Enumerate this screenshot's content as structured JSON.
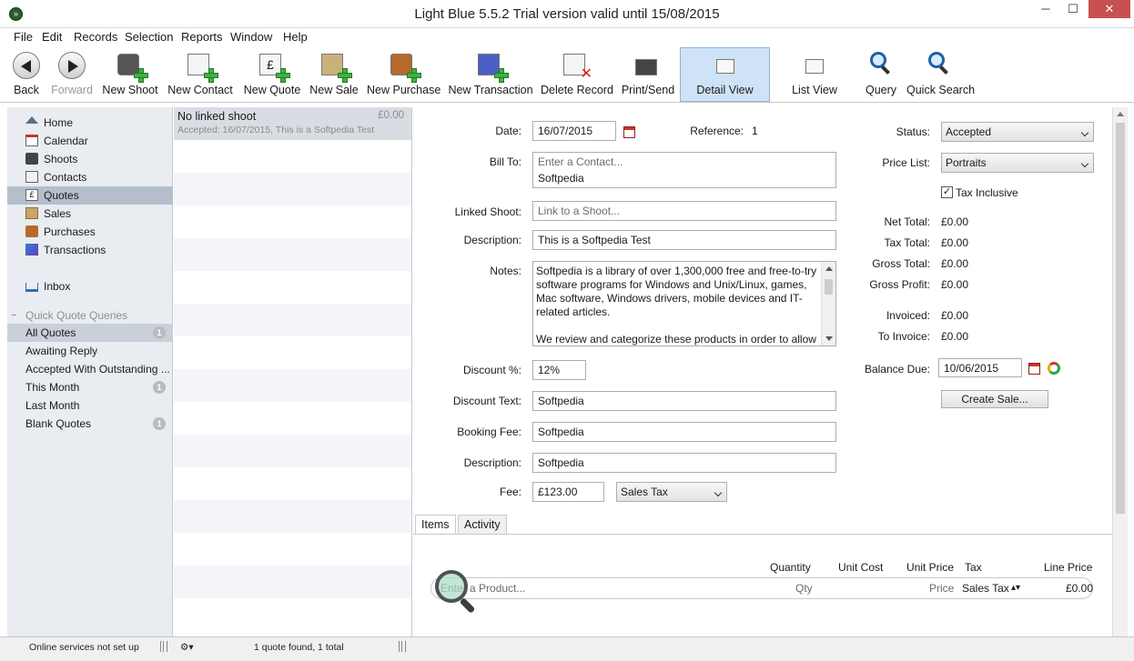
{
  "window": {
    "title": "Light Blue 5.5.2    Trial version valid until 15/08/2015",
    "minimize": "─",
    "maximize": "☐",
    "close": "✕"
  },
  "menu": [
    "File",
    "Edit",
    "Records",
    "Selection",
    "Reports",
    "Window",
    "Help"
  ],
  "toolbar": {
    "back": "Back",
    "forward": "Forward",
    "new_shoot": "New Shoot",
    "new_contact": "New Contact",
    "new_quote": "New Quote",
    "new_sale": "New Sale",
    "new_purchase": "New Purchase",
    "new_transaction": "New Transaction",
    "delete_record": "Delete Record",
    "print_send": "Print/Send",
    "detail_view": "Detail View",
    "list_view": "List View",
    "query": "Query",
    "quick_search": "Quick Search"
  },
  "sidebar": {
    "items": [
      {
        "label": "Home",
        "icon": "home-icon"
      },
      {
        "label": "Calendar",
        "icon": "calendar-icon"
      },
      {
        "label": "Shoots",
        "icon": "camera-icon"
      },
      {
        "label": "Contacts",
        "icon": "contacts-icon"
      },
      {
        "label": "Quotes",
        "icon": "quote-icon"
      },
      {
        "label": "Sales",
        "icon": "sales-icon"
      },
      {
        "label": "Purchases",
        "icon": "purchases-icon"
      },
      {
        "label": "Transactions",
        "icon": "transactions-icon"
      }
    ],
    "inbox": "Inbox",
    "queries_header": "Quick Quote Queries",
    "queries": [
      {
        "label": "All Quotes",
        "badge": "1"
      },
      {
        "label": "Awaiting Reply",
        "badge": ""
      },
      {
        "label": "Accepted With Outstanding ...",
        "badge": ""
      },
      {
        "label": "This Month",
        "badge": "1"
      },
      {
        "label": "Last Month",
        "badge": ""
      },
      {
        "label": "Blank Quotes",
        "badge": "1"
      }
    ]
  },
  "list": {
    "record": {
      "title": "No linked shoot",
      "amount": "£0.00",
      "subtitle": "Accepted: 16/07/2015, This is a Softpedia Test"
    }
  },
  "detail": {
    "date_label": "Date:",
    "date_value": "16/07/2015",
    "reference_label": "Reference:",
    "reference_value": "1",
    "bill_to_label": "Bill To:",
    "bill_to_placeholder": "Enter a Contact...",
    "bill_to_value": "Softpedia",
    "linked_shoot_label": "Linked Shoot:",
    "linked_shoot_placeholder": "Link to a Shoot...",
    "description_label": "Description:",
    "description_value": "This is a Softpedia Test",
    "notes_label": "Notes:",
    "notes_p1": "Softpedia is a library of over 1,300,000 free and free-to-try software programs for Windows and Unix/Linux, games, Mac software, Windows drivers, mobile devices and IT-related articles.",
    "notes_p2": "We review and categorize these products in order to allow",
    "discount_pct_label": "Discount %:",
    "discount_pct_value": "12%",
    "discount_text_label": "Discount Text:",
    "discount_text_value": "Softpedia",
    "booking_fee_label": "Booking Fee:",
    "booking_fee_value": "Softpedia",
    "fee_description_label": "Description:",
    "fee_description_value": "Softpedia",
    "fee_label": "Fee:",
    "fee_value": "£123.00",
    "fee_tax": "Sales Tax",
    "status_label": "Status:",
    "status_value": "Accepted",
    "price_list_label": "Price List:",
    "price_list_value": "Portraits",
    "tax_inclusive_label": "Tax Inclusive",
    "net_total_label": "Net Total:",
    "net_total_value": "£0.00",
    "tax_total_label": "Tax Total:",
    "tax_total_value": "£0.00",
    "gross_total_label": "Gross Total:",
    "gross_total_value": "£0.00",
    "gross_profit_label": "Gross Profit:",
    "gross_profit_value": "£0.00",
    "invoiced_label": "Invoiced:",
    "invoiced_value": "£0.00",
    "to_invoice_label": "To Invoice:",
    "to_invoice_value": "£0.00",
    "balance_due_label": "Balance Due:",
    "balance_due_date": "10/06/2015",
    "create_sale": "Create Sale..."
  },
  "tabs": [
    "Items",
    "Activity"
  ],
  "items": {
    "headers": {
      "quantity": "Quantity",
      "unit_cost": "Unit Cost",
      "unit_price": "Unit Price",
      "tax": "Tax",
      "line_price": "Line Price"
    },
    "product_placeholder": "Enter a Product...",
    "qty_placeholder": "Qty",
    "price_placeholder": "Price",
    "tax_value": "Sales Tax",
    "line_price_value": "£0.00"
  },
  "status": {
    "online": "Online services not set up",
    "count": "1 quote found, 1 total"
  },
  "colors": {
    "sidebar_bg": "#e9ecf0",
    "selection": "#b5bfcc",
    "active_tool": "#cfe3f7"
  }
}
